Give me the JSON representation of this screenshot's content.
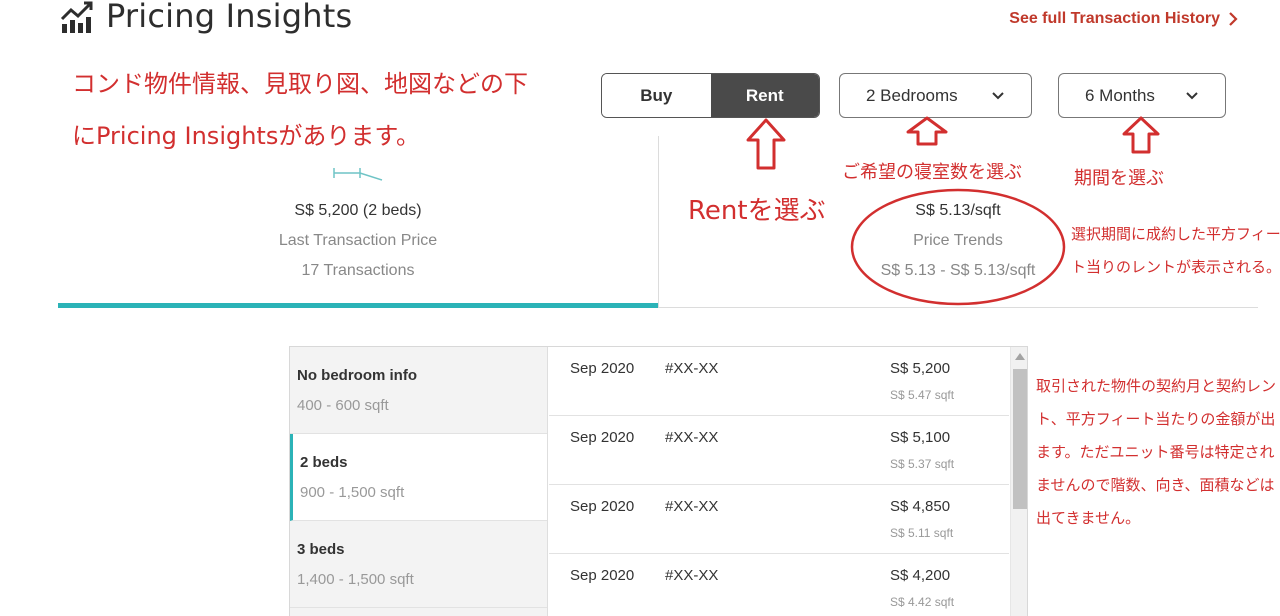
{
  "header": {
    "title": "Pricing Insights",
    "history_link": "See full Transaction History"
  },
  "annotations": {
    "intro": "コンド物件情報、見取り図、地図などの下にPricing Insightsがあります。",
    "rent": "Rentを選ぶ",
    "bedrooms": "ご希望の寝室数を選ぶ",
    "period": "期間を選ぶ",
    "trend": "選択期間に成約した平方フィート当りのレントが表示される。",
    "list": "取引された物件の契約月と契約レント、平方フィート当たりの金額が出ます。ただユニット番号は特定されませんので階数、向き、面積などは出てきません。"
  },
  "controls": {
    "buy_label": "Buy",
    "rent_label": "Rent",
    "active_mode": "Rent",
    "bedrooms_value": "2 Bedrooms",
    "period_value": "6 Months"
  },
  "summary": {
    "last_price": "S$ 5,200 (2 beds)",
    "last_price_label": "Last Transaction Price",
    "transactions": "17 Transactions",
    "trend_value": "S$ 5.13/sqft",
    "trend_label": "Price Trends",
    "trend_range": "S$ 5.13 - S$ 5.13/sqft"
  },
  "bed_options": [
    {
      "name": "No bedroom info",
      "range": "400 - 600 sqft",
      "selected": false
    },
    {
      "name": "2 beds",
      "range": "900 - 1,500 sqft",
      "selected": true
    },
    {
      "name": "3 beds",
      "range": "1,400 - 1,500 sqft",
      "selected": false
    }
  ],
  "transactions": [
    {
      "date": "Sep 2020",
      "unit": "#XX-XX",
      "price": "S$ 5,200",
      "psf": "S$ 5.47 sqft"
    },
    {
      "date": "Sep 2020",
      "unit": "#XX-XX",
      "price": "S$ 5,100",
      "psf": "S$ 5.37 sqft"
    },
    {
      "date": "Sep 2020",
      "unit": "#XX-XX",
      "price": "S$ 4,850",
      "psf": "S$ 5.11 sqft"
    },
    {
      "date": "Sep 2020",
      "unit": "#XX-XX",
      "price": "S$ 4,200",
      "psf": "S$ 4.42 sqft"
    }
  ],
  "colors": {
    "accent": "#2bb3b7",
    "link": "#c0392b",
    "annotation": "#d22f2f",
    "toggle_active": "#4a4a4a"
  },
  "icons": {
    "title": "chart-icon",
    "link": "chevron-right-icon",
    "select": "chevron-down-icon"
  }
}
